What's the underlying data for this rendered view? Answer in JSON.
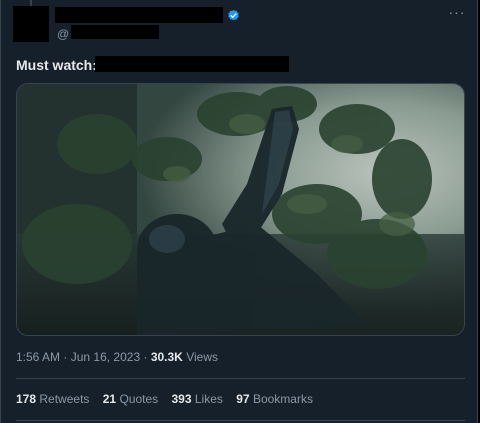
{
  "tweet": {
    "text_prefix": "Must watch:",
    "handle_prefix": "@",
    "more_label": "···",
    "time": "1:56 AM",
    "separator": "·",
    "date": "Jun 16, 2023",
    "views_count": "30.3K",
    "views_label": "Views"
  },
  "stats": [
    {
      "value": "178",
      "label": "Retweets"
    },
    {
      "value": "21",
      "label": "Quotes"
    },
    {
      "value": "393",
      "label": "Likes"
    },
    {
      "value": "97",
      "label": "Bookmarks"
    }
  ],
  "colors": {
    "background": "#15202b",
    "verified": "#1d9bf0",
    "secondary_text": "#8b98a5",
    "divider": "#38444d"
  },
  "icons": {
    "verified": "verified-badge-icon",
    "more": "more-options-icon"
  }
}
